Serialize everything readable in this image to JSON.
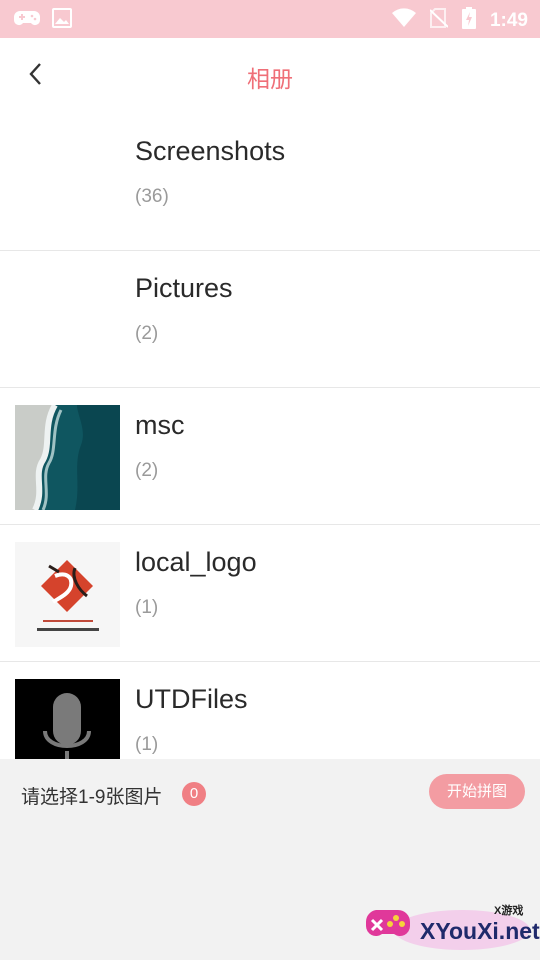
{
  "status_bar": {
    "time": "1:49",
    "background": "#f8c9d0"
  },
  "header": {
    "title": "相册",
    "back_icon": "chevron-left-icon",
    "title_color": "#ef6f78"
  },
  "albums": [
    {
      "name": "Screenshots",
      "count": "(36)",
      "thumbnail": "none"
    },
    {
      "name": "Pictures",
      "count": "(2)",
      "thumbnail": "none"
    },
    {
      "name": "msc",
      "count": "(2)",
      "thumbnail": "ocean-shore-image"
    },
    {
      "name": "local_logo",
      "count": "(1)",
      "thumbnail": "red-logo-image"
    },
    {
      "name": "UTDFiles",
      "count": "(1)",
      "thumbnail": "microphone-image"
    }
  ],
  "bottom_bar": {
    "hint": "请选择1-9张图片",
    "selected_count": "0",
    "start_button": "开始拼图"
  },
  "watermark": {
    "text": "XYouXi.net",
    "small": "X游戏"
  }
}
